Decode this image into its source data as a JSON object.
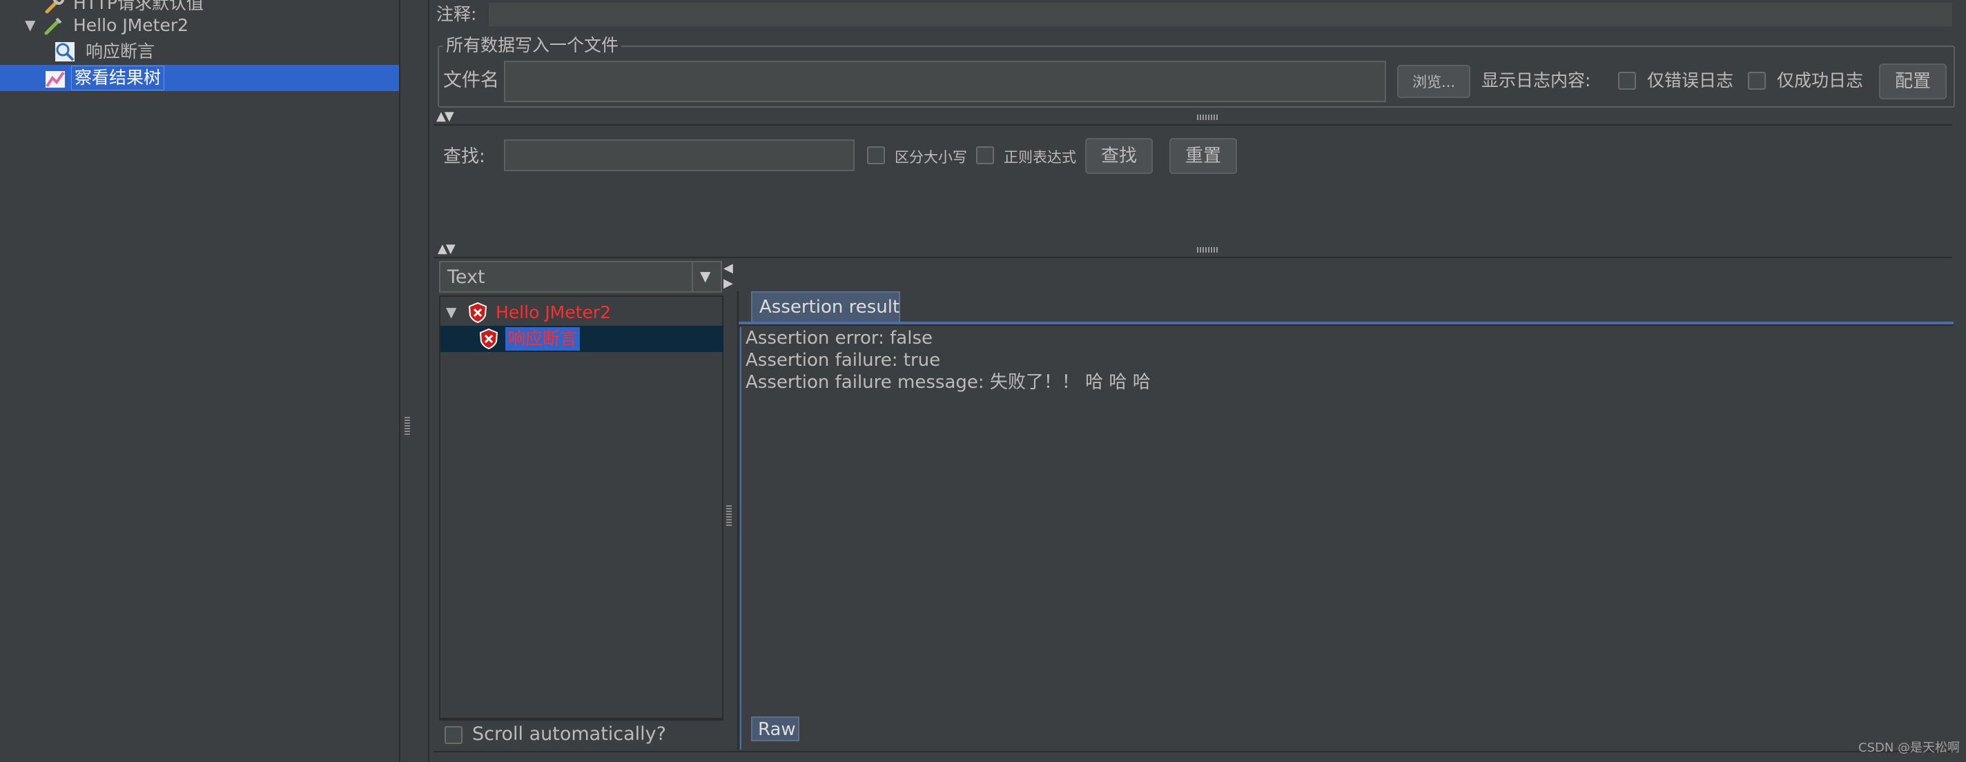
{
  "tree": {
    "items": [
      {
        "label": "HTTP请求默认值",
        "icon": "wrench-icon"
      },
      {
        "label": "Hello JMeter2",
        "icon": "pipette-icon",
        "expanded": true
      },
      {
        "label": "响应断言",
        "icon": "magnifier-icon"
      },
      {
        "label": "察看结果树",
        "icon": "chart-icon",
        "selected": true
      }
    ]
  },
  "comment": {
    "label": "注释:"
  },
  "file_section": {
    "title": "所有数据写入一个文件",
    "filename_label": "文件名",
    "filename_value": "",
    "browse_button": "浏览...",
    "show_log_label": "显示日志内容:",
    "error_only_label": "仅错误日志",
    "success_only_label": "仅成功日志",
    "config_button": "配置"
  },
  "search": {
    "label": "查找:",
    "value": "",
    "case_label": "区分大小写",
    "regex_label": "正则表达式",
    "find_button": "查找",
    "reset_button": "重置"
  },
  "renderer": {
    "selected": "Text"
  },
  "result_tree": {
    "items": [
      {
        "label": "Hello JMeter2",
        "status": "error"
      },
      {
        "label": "响应断言",
        "status": "error",
        "selected": true
      }
    ]
  },
  "scroll_auto_label": "Scroll automatically?",
  "tabs": {
    "active": "Assertion result",
    "bottom": "Raw"
  },
  "result": {
    "lines": [
      "Assertion error: false",
      "Assertion failure: true",
      "Assertion failure message: 失败了！！ 哈 哈  哈"
    ]
  },
  "watermark": "CSDN @是天松啊",
  "colors": {
    "accent": "#2f65ca",
    "error_text": "#ff2d2d",
    "background": "#3c3f41"
  }
}
